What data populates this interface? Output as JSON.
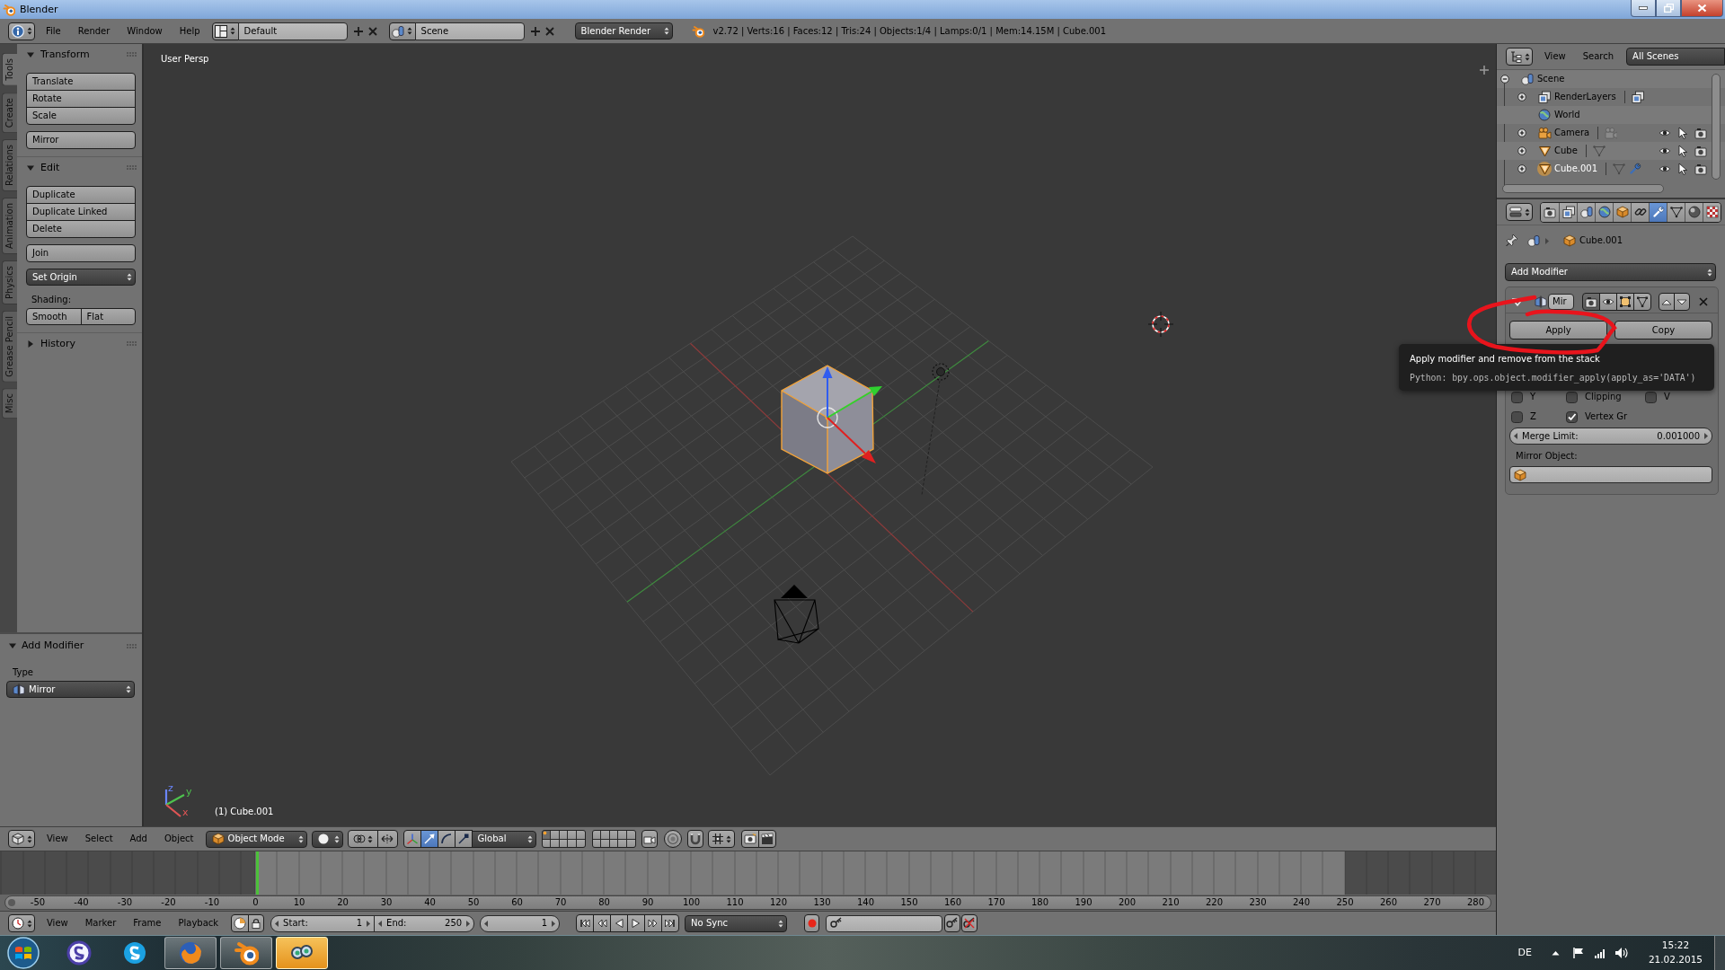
{
  "window": {
    "title": "Blender"
  },
  "info_header": {
    "menus": [
      "File",
      "Render",
      "Window",
      "Help"
    ],
    "screen_layout": "Default",
    "scene": "Scene",
    "render_engine": "Blender Render",
    "stats": "v2.72 | Verts:16 | Faces:12 | Tris:24 | Objects:1/4 | Lamps:0/1 | Mem:14.15M | Cube.001"
  },
  "tool_shelf": {
    "tabs": [
      {
        "label": "Tools",
        "selected": true
      },
      {
        "label": "Create",
        "selected": false
      },
      {
        "label": "Relations",
        "selected": false
      },
      {
        "label": "Animation",
        "selected": false
      },
      {
        "label": "Physics",
        "selected": false
      },
      {
        "label": "Grease Pencil",
        "selected": false
      },
      {
        "label": "Misc",
        "selected": false
      }
    ],
    "panels": [
      {
        "title": "Transform",
        "expanded": true,
        "items": [
          {
            "kind": "buttons",
            "labels": [
              "Translate",
              "Rotate",
              "Scale"
            ]
          },
          {
            "kind": "buttons",
            "labels": [
              "Mirror"
            ]
          }
        ]
      },
      {
        "title": "Edit",
        "expanded": true,
        "items": [
          {
            "kind": "buttons",
            "labels": [
              "Duplicate",
              "Duplicate Linked",
              "Delete"
            ]
          },
          {
            "kind": "buttons",
            "labels": [
              "Join"
            ]
          },
          {
            "kind": "dropdown",
            "label": "Set Origin"
          },
          {
            "kind": "label",
            "label": "Shading:"
          },
          {
            "kind": "row",
            "labels": [
              "Smooth",
              "Flat"
            ]
          }
        ]
      },
      {
        "title": "History",
        "expanded": false
      }
    ]
  },
  "operator_panel": {
    "title": "Add Modifier",
    "expanded": true,
    "type_label": "Type",
    "type_value": "Mirror"
  },
  "viewport": {
    "view_name": "User Persp",
    "axis_labels": [
      "z",
      "y",
      "x"
    ],
    "object_label": "(1) Cube.001"
  },
  "viewport_header": {
    "menus": [
      "View",
      "Select",
      "Add",
      "Object"
    ],
    "mode": "Object Mode",
    "manipulators": [
      {
        "kind": "translate",
        "selected": true
      },
      {
        "kind": "rotate",
        "selected": false
      },
      {
        "kind": "scale",
        "selected": false
      }
    ],
    "orientation": "Global"
  },
  "timeline": {
    "ruler": [
      "-50",
      "-40",
      "-30",
      "-20",
      "-10",
      "0",
      "10",
      "20",
      "30",
      "40",
      "50",
      "60",
      "70",
      "80",
      "90",
      "100",
      "110",
      "120",
      "130",
      "140",
      "150",
      "160",
      "170",
      "180",
      "190",
      "200",
      "210",
      "220",
      "230",
      "240",
      "250",
      "260",
      "270",
      "280"
    ]
  },
  "timeline_header": {
    "menus": [
      "View",
      "Marker",
      "Frame",
      "Playback"
    ],
    "start_label": "Start:",
    "start": "1",
    "end_label": "End:",
    "end": "250",
    "current_frame": "1",
    "sync": "No Sync"
  },
  "outliner": {
    "menus": [
      "View",
      "Search"
    ],
    "filter": "All Scenes",
    "tree": [
      {
        "label": "Scene",
        "kind": "scene",
        "expanded": true,
        "selected": false,
        "children": [
          {
            "label": "RenderLayers",
            "kind": "renderlayers",
            "expanded": false,
            "selected": false,
            "has_modifier": false
          },
          {
            "label": "World",
            "kind": "world",
            "selected": false,
            "has_modifier": false
          },
          {
            "label": "Camera",
            "kind": "camera",
            "expanded": false,
            "selected": false,
            "has_modifier": false
          },
          {
            "label": "Cube",
            "kind": "mesh",
            "expanded": false,
            "selected": false,
            "has_modifier": false
          },
          {
            "label": "Cube.001",
            "kind": "mesh",
            "expanded": false,
            "selected": true,
            "has_modifier": true
          }
        ]
      }
    ]
  },
  "properties": {
    "tabs": [
      {
        "kind": "render",
        "selected": false
      },
      {
        "kind": "layers",
        "selected": false
      },
      {
        "kind": "scene",
        "selected": false
      },
      {
        "kind": "world",
        "selected": false
      },
      {
        "kind": "object",
        "selected": false
      },
      {
        "kind": "constraints",
        "selected": false
      },
      {
        "kind": "modifiers",
        "selected": true
      },
      {
        "kind": "data",
        "selected": false
      },
      {
        "kind": "material",
        "selected": false
      },
      {
        "kind": "texture",
        "selected": false
      }
    ],
    "breadcrumb": "Cube.001",
    "add_modifier": "Add Modifier",
    "modifier": {
      "name": "Mir",
      "expanded": true,
      "apply": "Apply",
      "copy": "Copy",
      "options": [
        [
          {
            "label": "Y",
            "checked": false
          },
          {
            "label": "Clipping",
            "checked": false
          },
          {
            "label": "V",
            "checked": false
          }
        ],
        [
          {
            "label": "Z",
            "checked": false
          },
          {
            "label": "Vertex Gr",
            "checked": true
          }
        ]
      ],
      "merge_label": "Merge Limit:",
      "merge_value": "0.001000",
      "mirror_object_label": "Mirror Object:"
    }
  },
  "tooltip": {
    "text": "Apply modifier and remove from the stack",
    "python": "Python: bpy.ops.object.modifier_apply(apply_as='DATA')"
  },
  "taskbar": {
    "apps": [
      {
        "kind": "ring",
        "running": false,
        "selected": false
      },
      {
        "kind": "cloud",
        "running": false,
        "selected": false
      },
      {
        "kind": "globe",
        "running": true,
        "selected": false
      },
      {
        "kind": "eye",
        "running": true,
        "selected": false
      },
      {
        "kind": "goggles",
        "running": true,
        "selected": true
      }
    ],
    "language": "DE",
    "time": "15:22",
    "date": "21.02.2015"
  }
}
